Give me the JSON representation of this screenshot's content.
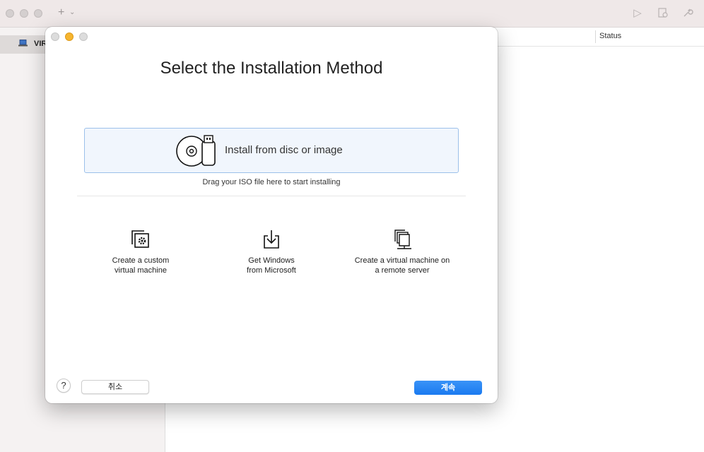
{
  "toolbar": {
    "add_label": "+",
    "chevron": "⌄",
    "icons": [
      "play-icon",
      "vm-settings-icon",
      "wrench-icon"
    ]
  },
  "sidebar": {
    "items": [
      {
        "label": "VIR",
        "icon": "laptop-icon"
      }
    ]
  },
  "list": {
    "columns": [
      "Status"
    ]
  },
  "sheet": {
    "title": "Select the Installation Method",
    "install_option": {
      "label": "Install from disc or image",
      "icon": "disc-usb-icon"
    },
    "drag_hint": "Drag your ISO file here to start installing",
    "options": [
      {
        "line1": "Create a custom",
        "line2": "virtual machine",
        "icon": "custom-vm-icon"
      },
      {
        "line1": "Get Windows",
        "line2": "from Microsoft",
        "icon": "download-icon"
      },
      {
        "line1": "Create a virtual machine on",
        "line2": "a remote server",
        "icon": "remote-server-icon"
      }
    ],
    "help_label": "?",
    "cancel_label": "취소",
    "continue_label": "계속"
  },
  "colors": {
    "accent": "#1a7af0",
    "minimize": "#f6b52f",
    "install_bg": "#f1f6fd",
    "install_border": "#9cc0ea"
  }
}
